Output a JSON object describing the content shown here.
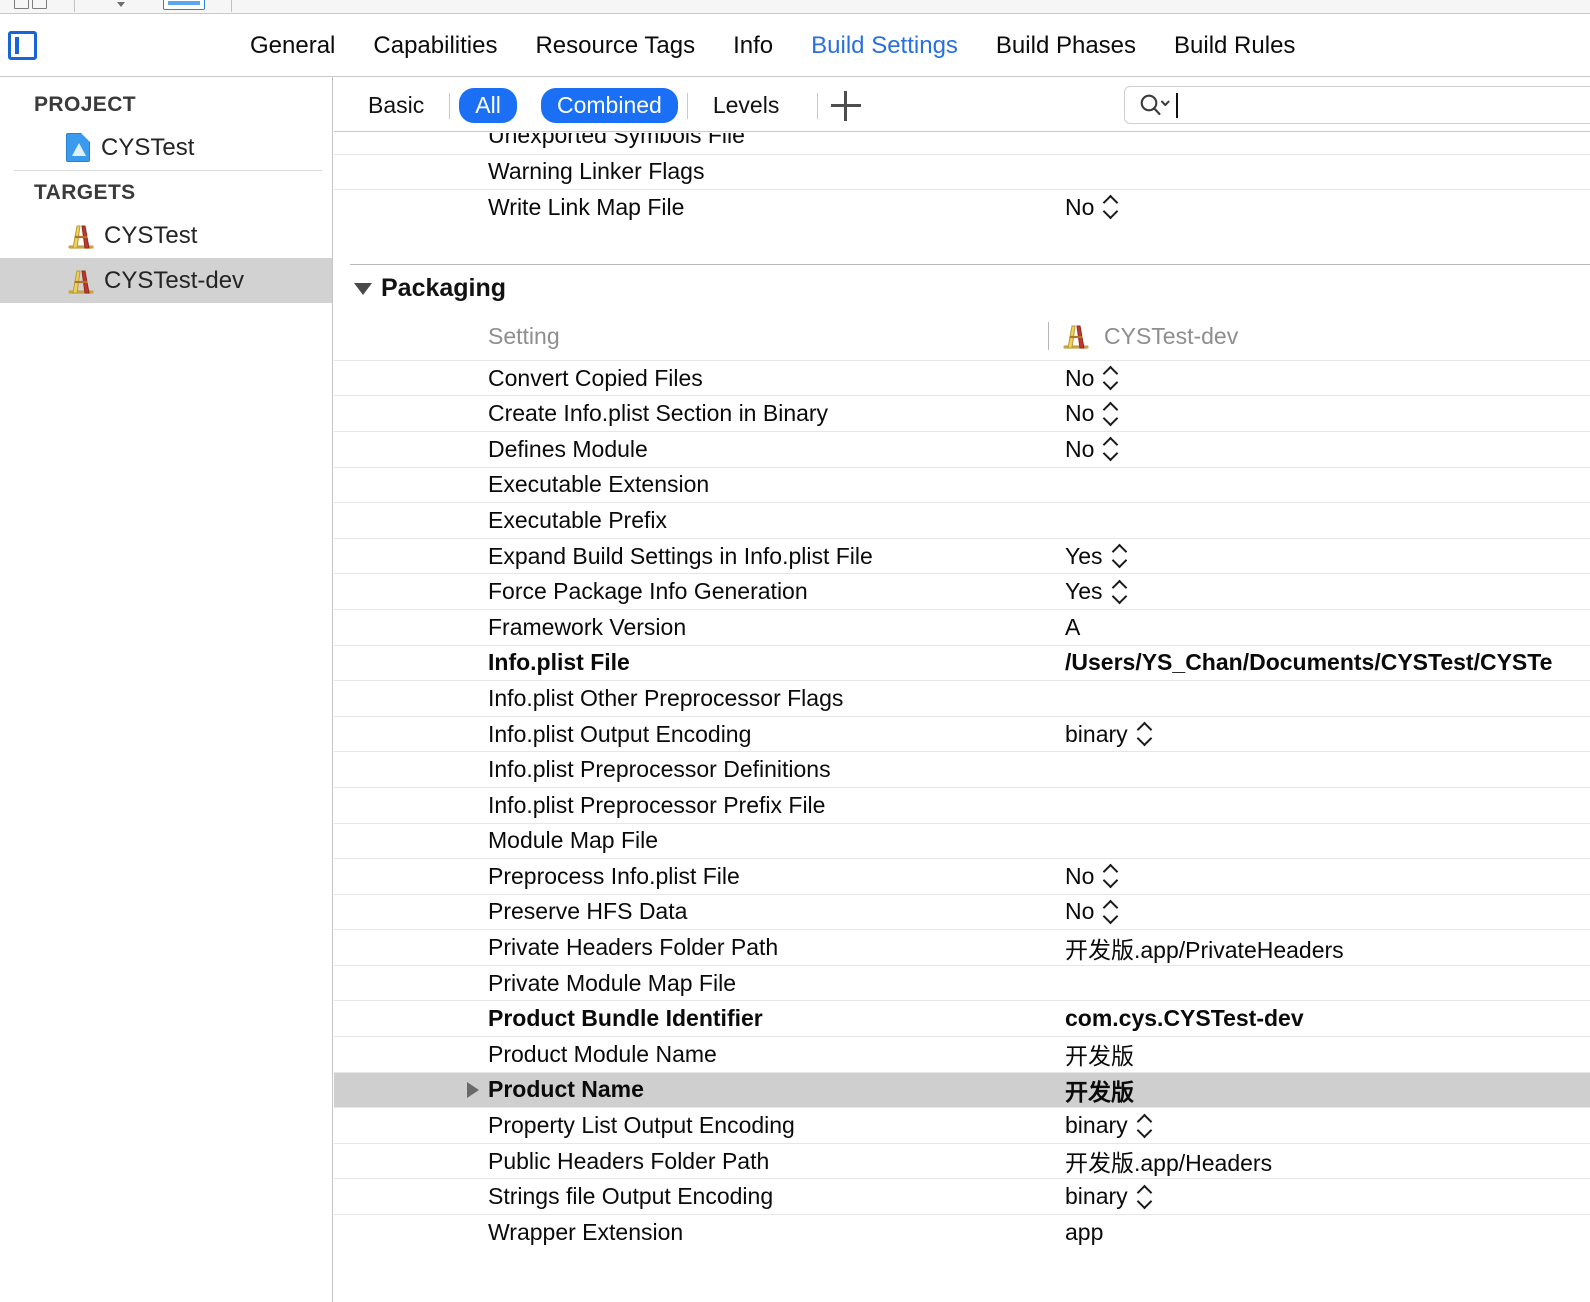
{
  "toolbar": {
    "panes_icon": "editor-panes-icon",
    "back_icon": "chevron-down-icon",
    "forward_icon": "chevron-up-icon",
    "editor_icon": "editor-area-icon"
  },
  "navigator": {
    "toggle_icon": "navigator-toggle-icon"
  },
  "tabs": [
    {
      "label": "General",
      "active": false
    },
    {
      "label": "Capabilities",
      "active": false
    },
    {
      "label": "Resource Tags",
      "active": false
    },
    {
      "label": "Info",
      "active": false
    },
    {
      "label": "Build Settings",
      "active": true
    },
    {
      "label": "Build Phases",
      "active": false
    },
    {
      "label": "Build Rules",
      "active": false
    }
  ],
  "sidebar": {
    "project_header": "PROJECT",
    "targets_header": "TARGETS",
    "project_items": [
      {
        "label": "CYSTest",
        "icon": "project-document-icon",
        "selected": false
      }
    ],
    "target_items": [
      {
        "label": "CYSTest",
        "icon": "target-icon",
        "selected": false
      },
      {
        "label": "CYSTest-dev",
        "icon": "target-icon",
        "selected": true
      }
    ]
  },
  "filterbar": {
    "scope": [
      {
        "label": "Basic",
        "on": false
      },
      {
        "label": "All",
        "on": true
      }
    ],
    "mode": [
      {
        "label": "Combined",
        "on": true
      },
      {
        "label": "Levels",
        "on": false
      }
    ],
    "add_icon": "plus-icon",
    "add_label": "+"
  },
  "search": {
    "icon": "search-icon",
    "dropdown_icon": "chevron-down-icon",
    "value": "",
    "placeholder": ""
  },
  "table": {
    "column_headers": {
      "setting": "Setting",
      "target": "CYSTest-dev",
      "target_icon": "target-icon"
    },
    "rows_above": [
      {
        "name": "Unexported Symbols File",
        "value": "",
        "type": "text",
        "bold": false,
        "clipped": true
      },
      {
        "name": "Warning Linker Flags",
        "value": "",
        "type": "text",
        "bold": false
      },
      {
        "name": "Write Link Map File",
        "value": "No",
        "type": "popup",
        "bold": false
      }
    ],
    "section": {
      "title": "Packaging",
      "expanded": true,
      "disclosure_icon": "triangle-down-icon"
    },
    "rows": [
      {
        "name": "Convert Copied Files",
        "value": "No",
        "type": "popup",
        "bold": false,
        "selected": false
      },
      {
        "name": "Create Info.plist Section in Binary",
        "value": "No",
        "type": "popup",
        "bold": false,
        "selected": false
      },
      {
        "name": "Defines Module",
        "value": "No",
        "type": "popup",
        "bold": false,
        "selected": false
      },
      {
        "name": "Executable Extension",
        "value": "",
        "type": "text",
        "bold": false,
        "selected": false
      },
      {
        "name": "Executable Prefix",
        "value": "",
        "type": "text",
        "bold": false,
        "selected": false
      },
      {
        "name": "Expand Build Settings in Info.plist File",
        "value": "Yes",
        "type": "popup",
        "bold": false,
        "selected": false
      },
      {
        "name": "Force Package Info Generation",
        "value": "Yes",
        "type": "popup",
        "bold": false,
        "selected": false
      },
      {
        "name": "Framework Version",
        "value": "A",
        "type": "text",
        "bold": false,
        "selected": false
      },
      {
        "name": "Info.plist File",
        "value": "/Users/YS_Chan/Documents/CYSTest/CYSTe",
        "type": "text",
        "bold": true,
        "selected": false
      },
      {
        "name": "Info.plist Other Preprocessor Flags",
        "value": "",
        "type": "text",
        "bold": false,
        "selected": false
      },
      {
        "name": "Info.plist Output Encoding",
        "value": "binary",
        "type": "popup",
        "bold": false,
        "selected": false
      },
      {
        "name": "Info.plist Preprocessor Definitions",
        "value": "",
        "type": "text",
        "bold": false,
        "selected": false
      },
      {
        "name": "Info.plist Preprocessor Prefix File",
        "value": "",
        "type": "text",
        "bold": false,
        "selected": false
      },
      {
        "name": "Module Map File",
        "value": "",
        "type": "text",
        "bold": false,
        "selected": false
      },
      {
        "name": "Preprocess Info.plist File",
        "value": "No",
        "type": "popup",
        "bold": false,
        "selected": false
      },
      {
        "name": "Preserve HFS Data",
        "value": "No",
        "type": "popup",
        "bold": false,
        "selected": false
      },
      {
        "name": "Private Headers Folder Path",
        "value": "开发版.app/PrivateHeaders",
        "type": "text",
        "bold": false,
        "selected": false
      },
      {
        "name": "Private Module Map File",
        "value": "",
        "type": "text",
        "bold": false,
        "selected": false
      },
      {
        "name": "Product Bundle Identifier",
        "value": "com.cys.CYSTest-dev",
        "type": "text",
        "bold": true,
        "selected": false
      },
      {
        "name": "Product Module Name",
        "value": "开发版",
        "type": "text",
        "bold": false,
        "selected": false
      },
      {
        "name": "Product Name",
        "value": "开发版",
        "type": "text",
        "bold": true,
        "selected": true,
        "disclosure_icon": "triangle-right-icon"
      },
      {
        "name": "Property List Output Encoding",
        "value": "binary",
        "type": "popup",
        "bold": false,
        "selected": false
      },
      {
        "name": "Public Headers Folder Path",
        "value": "开发版.app/Headers",
        "type": "text",
        "bold": false,
        "selected": false
      },
      {
        "name": "Strings file Output Encoding",
        "value": "binary",
        "type": "popup",
        "bold": false,
        "selected": false
      },
      {
        "name": "Wrapper Extension",
        "value": "app",
        "type": "text",
        "bold": false,
        "selected": false
      }
    ]
  },
  "colors": {
    "accent": "#1a6ff5",
    "active_tab": "#2a6fe0",
    "selection_gray": "#cfcfcf",
    "sidebar_selection": "#d2d2d2",
    "muted_text": "#8e8e8e"
  }
}
